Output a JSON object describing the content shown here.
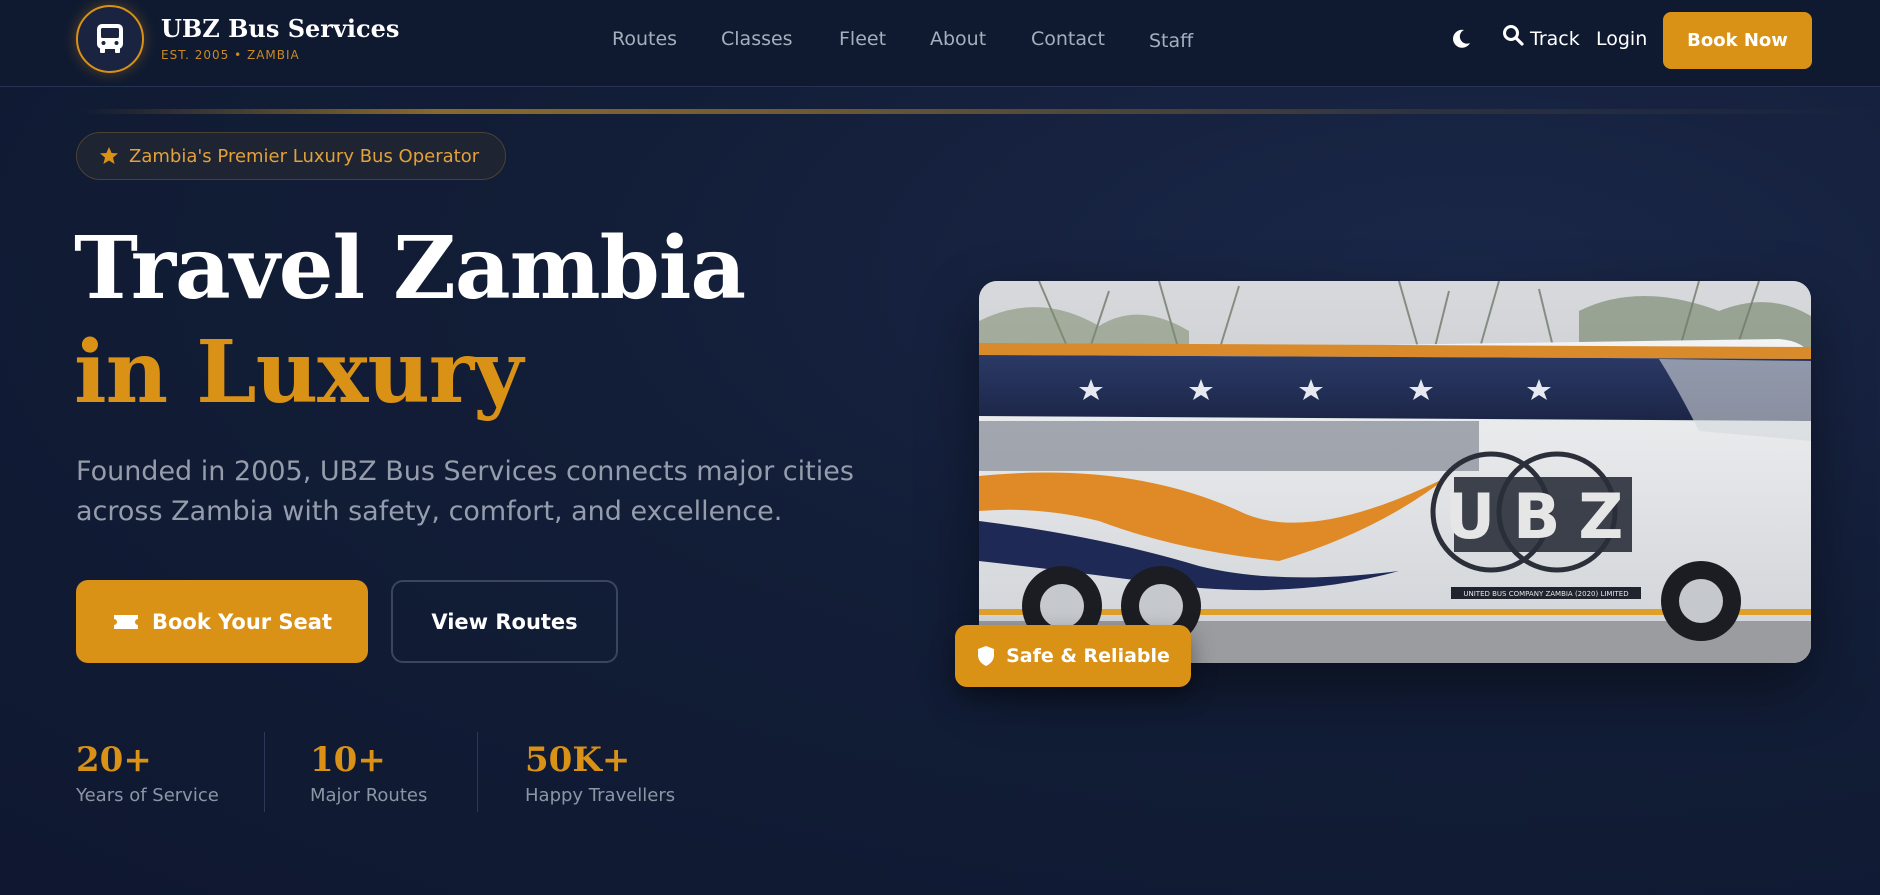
{
  "brand": {
    "name": "UBZ Bus Services",
    "subtitle": "EST. 2005 • ZAMBIA"
  },
  "nav": {
    "items": [
      "Routes",
      "Classes",
      "Fleet",
      "About",
      "Contact",
      "Staff"
    ],
    "track_label": "Track",
    "login_label": "Login",
    "book_now_label": "Book Now"
  },
  "hero": {
    "badge": "Zambia's Premier Luxury Bus Operator",
    "title_line1": "Travel Zambia",
    "title_line2": "in Luxury",
    "description": "Founded in 2005, UBZ Bus Services connects major cities across Zambia with safety, comfort, and excellence.",
    "primary_button": "Book Your Seat",
    "secondary_button": "View Routes",
    "image_badge": "Safe & Reliable",
    "bus_logo_text": "UBZ",
    "bus_small_text": "UNITED BUS COMPANY ZAMBIA (2020) LIMITED"
  },
  "stats": [
    {
      "value": "20+",
      "label": "Years of Service"
    },
    {
      "value": "10+",
      "label": "Major Routes"
    },
    {
      "value": "50K+",
      "label": "Happy Travellers"
    }
  ],
  "colors": {
    "accent": "#d99116",
    "background": "#121d37",
    "header": "#0f1a31"
  },
  "icons": {
    "logo": "bus-icon",
    "theme_toggle": "moon-icon",
    "track": "search-icon",
    "badge": "star-icon",
    "book_button": "ticket-icon",
    "image_badge": "shield-icon"
  }
}
